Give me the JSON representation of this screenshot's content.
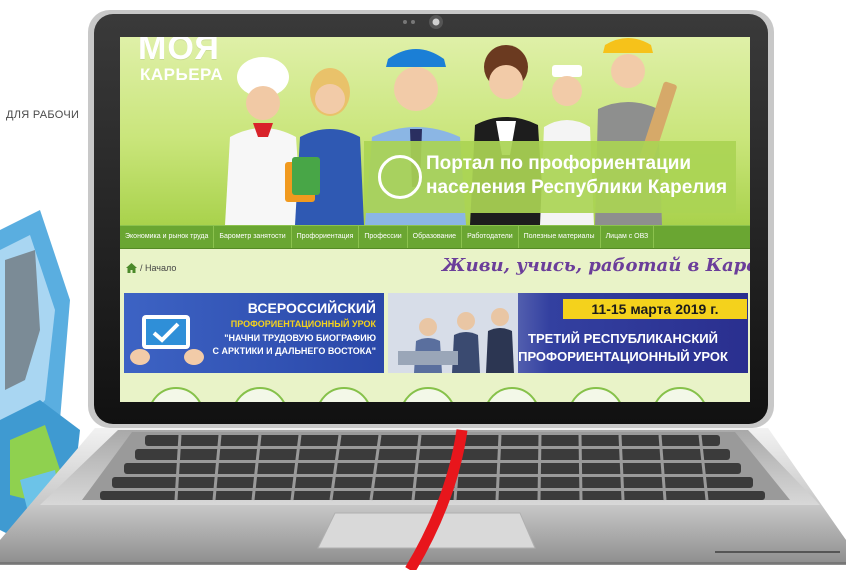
{
  "background": {
    "side_label": "ДЛЯ РАБОЧИ"
  },
  "site": {
    "logo": {
      "line1": "МОЯ",
      "line2": "КАРЬЕРА"
    },
    "portal_title": {
      "line1": "Портал по профориентации",
      "line2": "населения Республики Карелия"
    },
    "nav": [
      "Экономика и рынок труда",
      "Барометр занятости",
      "Профориентация",
      "Профессии",
      "Образование",
      "Работодатели",
      "Полезные материалы",
      "Лицам с ОВЗ"
    ],
    "breadcrumb": "/ Начало",
    "slogan": "Живи, учись, работай в Карелии!",
    "banner_left": {
      "line1": "ВСЕРОССИЙСКИЙ",
      "line2": "ПРОФОРИЕНТАЦИОННЫЙ УРОК",
      "line3": "\"НАЧНИ ТРУДОВУЮ БИОГРАФИЮ",
      "line4": "С АРКТИКИ И ДАЛЬНЕГО ВОСТОКА\""
    },
    "banner_right": {
      "date": "11-15 марта 2019 г.",
      "line1": "ТРЕТИЙ РЕСПУБЛИКАНСКИЙ",
      "line2": "ПРОФОРИЕНТАЦИОННЫЙ УРОК"
    }
  },
  "colors": {
    "nav_green": "#6aa632",
    "slogan_purple": "#6b3e9a",
    "banner_blue": "#2a47a8",
    "date_yellow": "#f4d21c",
    "red_cable": "#e8161c"
  }
}
